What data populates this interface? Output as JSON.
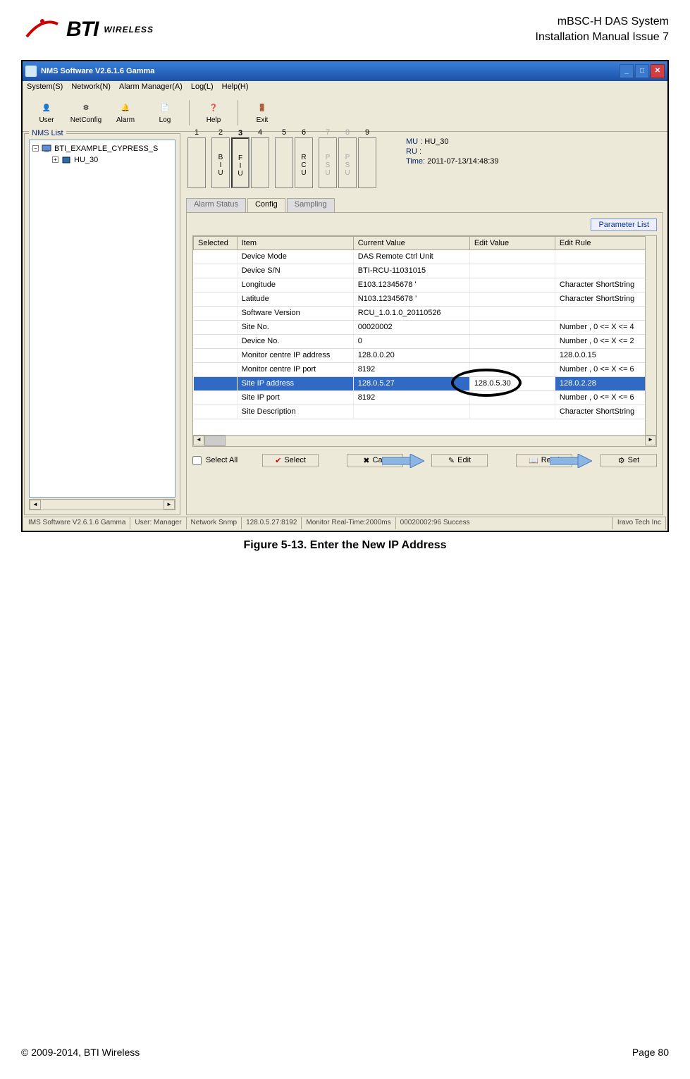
{
  "doc": {
    "header_line1": "mBSC-H DAS System",
    "header_line2": "Installation Manual Issue 7",
    "logo_bti": "BTI",
    "logo_wireless": "WIRELESS",
    "caption": "Figure 5-13. Enter the New IP Address",
    "copyright": "© 2009-2014, BTI Wireless",
    "page": "Page 80"
  },
  "titlebar": {
    "text": "NMS Software V2.6.1.6 Gamma"
  },
  "menubar": {
    "items": [
      "System(S)",
      "Network(N)",
      "Alarm Manager(A)",
      "Log(L)",
      "Help(H)"
    ]
  },
  "toolbar": {
    "items": [
      "User",
      "NetConfig",
      "Alarm",
      "Log",
      "Help",
      "Exit"
    ]
  },
  "nms": {
    "title": "NMS List",
    "root": "BTI_EXAMPLE_CYPRESS_S",
    "child": "HU_30"
  },
  "shelf": {
    "slots": [
      "1",
      "2",
      "3",
      "4",
      "5",
      "6",
      "7",
      "8",
      "9"
    ],
    "labels": {
      "2": "B\nI\nU",
      "3": "F\nI\nU",
      "6": "R\nC\nU",
      "7": "P\nS\nU",
      "8": "P\nS\nU"
    }
  },
  "info": {
    "mu_label": "MU :",
    "mu_val": "HU_30",
    "ru_label": "RU :",
    "ru_val": "",
    "time_label": "Time:",
    "time_val": "2011-07-13/14:48:39"
  },
  "tabs": {
    "t1": "Alarm Status",
    "t2": "Config",
    "t3": "Sampling"
  },
  "param_list": "Parameter List",
  "cols": {
    "c1": "Selected",
    "c2": "Item",
    "c3": "Current Value",
    "c4": "Edit Value",
    "c5": "Edit Rule"
  },
  "rows": [
    {
      "item": "Device Mode",
      "cur": "DAS Remote Ctrl Unit",
      "edit": "",
      "rule": ""
    },
    {
      "item": "Device S/N",
      "cur": "BTI-RCU-11031015",
      "edit": "",
      "rule": ""
    },
    {
      "item": "Longitude",
      "cur": "E103.12345678 '",
      "edit": "",
      "rule": "Character ShortString"
    },
    {
      "item": "Latitude",
      "cur": "N103.12345678 '",
      "edit": "",
      "rule": "Character ShortString"
    },
    {
      "item": "Software Version",
      "cur": "RCU_1.0.1.0_20110526",
      "edit": "",
      "rule": ""
    },
    {
      "item": "Site No.",
      "cur": "00020002",
      "edit": "",
      "rule": "Number , 0 <= X <= 4"
    },
    {
      "item": "Device No.",
      "cur": "0",
      "edit": "",
      "rule": "Number , 0 <= X <= 2"
    },
    {
      "item": "Monitor centre IP address",
      "cur": "128.0.0.20",
      "edit": "",
      "rule": "128.0.0.15"
    },
    {
      "item": "Monitor centre IP port",
      "cur": "8192",
      "edit": "",
      "rule": "Number , 0 <= X <= 6"
    },
    {
      "item": "Site IP address",
      "cur": "128.0.5.27",
      "edit": "128.0.5.30",
      "rule": "128.0.2.28",
      "selected": true
    },
    {
      "item": "Site IP port",
      "cur": "8192",
      "edit": "",
      "rule": "Number , 0 <= X <= 6"
    },
    {
      "item": "Site Description",
      "cur": "",
      "edit": "",
      "rule": "Character ShortString"
    }
  ],
  "bottom": {
    "select_all": "Select All",
    "select": "Select",
    "cancel": "Can",
    "edit": "Edit",
    "read": "Read",
    "set": "Set"
  },
  "status": {
    "s1": "IMS Software V2.6.1.6 Gamma",
    "s2": "User: Manager",
    "s3": "Network Snmp",
    "s4": "128.0.5.27:8192",
    "s5": "Monitor Real-Time:2000ms",
    "s6": "00020002:96 Success",
    "s7": "Iravo Tech Inc"
  }
}
